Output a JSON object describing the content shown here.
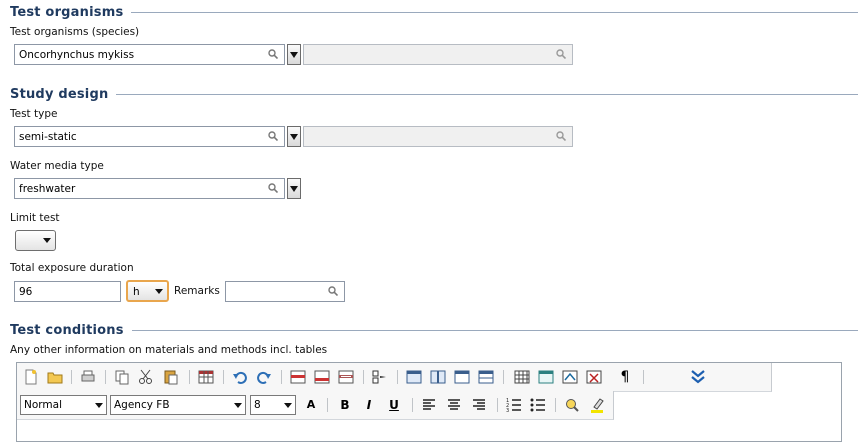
{
  "sections": {
    "test_organisms": "Test organisms",
    "study_design": "Study design",
    "test_conditions": "Test conditions"
  },
  "fields": {
    "organism_label": "Test organisms (species)",
    "organism_value": "Oncorhynchus mykiss",
    "test_type_label": "Test type",
    "test_type_value": "semi-static",
    "water_media_label": "Water media type",
    "water_media_value": "freshwater",
    "limit_test_label": "Limit test",
    "limit_test_value": "",
    "duration_label": "Total exposure duration",
    "duration_value": "96",
    "duration_unit": "h",
    "remarks_label": "Remarks",
    "remarks_value": ""
  },
  "editor": {
    "label": "Any other information on materials and methods incl. tables",
    "style_value": "Normal",
    "font_value": "Agency FB",
    "size_value": "8",
    "bold": "B",
    "italic": "I",
    "underline": "U",
    "pilcrow": "¶",
    "font_grow": "A"
  }
}
